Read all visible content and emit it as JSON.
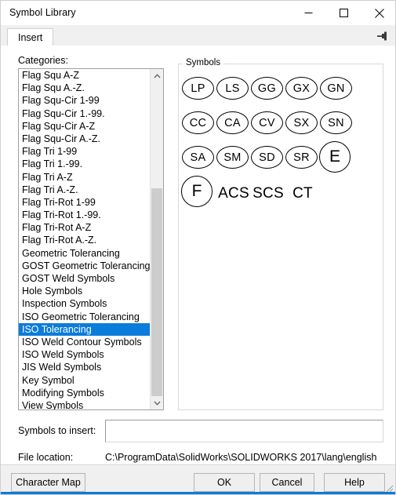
{
  "window": {
    "title": "Symbol Library",
    "controls": {
      "minimize": "minimize-icon",
      "maximize": "maximize-icon",
      "close": "close-icon"
    }
  },
  "tabs": {
    "items": [
      {
        "label": "Insert",
        "active": true
      }
    ],
    "pin": "pushpin-icon"
  },
  "categories": {
    "label": "Categories:",
    "selected": "ISO Tolerancing",
    "items": [
      "Flag Squ A-Z",
      "Flag Squ A.-Z.",
      "Flag Squ-Cir 1-99",
      "Flag Squ-Cir 1.-99.",
      "Flag Squ-Cir A-Z",
      "Flag Squ-Cir A.-Z.",
      "Flag Tri 1-99",
      "Flag Tri 1.-99.",
      "Flag Tri A-Z",
      "Flag Tri A.-Z.",
      "Flag Tri-Rot 1-99",
      "Flag Tri-Rot 1.-99.",
      "Flag Tri-Rot A-Z",
      "Flag Tri-Rot A.-Z.",
      "Geometric Tolerancing",
      "GOST Geometric Tolerancing",
      "GOST Weld Symbols",
      "Hole Symbols",
      "Inspection Symbols",
      "ISO Geometric Tolerancing",
      "ISO Tolerancing",
      "ISO Weld Contour Symbols",
      "ISO Weld Symbols",
      "JIS Weld Symbols",
      "Key Symbol",
      "Modifying Symbols",
      "View Symbols"
    ],
    "scrollbar": {
      "up_arrow": "chevron-up-icon",
      "down_arrow": "chevron-down-icon"
    }
  },
  "symbols": {
    "label": "Symbols",
    "items": [
      {
        "text": "LP",
        "shape": "oval",
        "row": 0,
        "col": 0
      },
      {
        "text": "LS",
        "shape": "oval",
        "row": 0,
        "col": 1
      },
      {
        "text": "GG",
        "shape": "oval",
        "row": 0,
        "col": 2
      },
      {
        "text": "GX",
        "shape": "oval",
        "row": 0,
        "col": 3
      },
      {
        "text": "GN",
        "shape": "oval",
        "row": 0,
        "col": 4
      },
      {
        "text": "CC",
        "shape": "oval",
        "row": 1,
        "col": 0
      },
      {
        "text": "CA",
        "shape": "oval",
        "row": 1,
        "col": 1
      },
      {
        "text": "CV",
        "shape": "oval",
        "row": 1,
        "col": 2
      },
      {
        "text": "SX",
        "shape": "oval",
        "row": 1,
        "col": 3
      },
      {
        "text": "SN",
        "shape": "oval",
        "row": 1,
        "col": 4
      },
      {
        "text": "SA",
        "shape": "oval",
        "row": 2,
        "col": 0
      },
      {
        "text": "SM",
        "shape": "oval",
        "row": 2,
        "col": 1
      },
      {
        "text": "SD",
        "shape": "oval",
        "row": 2,
        "col": 2
      },
      {
        "text": "SR",
        "shape": "oval",
        "row": 2,
        "col": 3
      },
      {
        "text": "E",
        "shape": "circle",
        "row": 2,
        "col": 4
      },
      {
        "text": "F",
        "shape": "circle",
        "row": 3,
        "col": 0
      },
      {
        "text": "ACS",
        "shape": "plain",
        "row": 3,
        "col": 1
      },
      {
        "text": "SCS",
        "shape": "plain",
        "row": 3,
        "col": 2
      },
      {
        "text": "CT",
        "shape": "plain",
        "row": 3,
        "col": 3
      }
    ]
  },
  "insert_field": {
    "label": "Symbols to insert:",
    "value": "",
    "placeholder": ""
  },
  "file_location": {
    "label": "File location:",
    "value": "C:\\ProgramData\\SolidWorks\\SOLIDWORKS 2017\\lang\\english"
  },
  "footer": {
    "character_map": "Character Map",
    "ok": "OK",
    "cancel": "Cancel",
    "help": "Help"
  },
  "colors": {
    "selection": "#0a7cdb",
    "window_bg": "#f0f0f0",
    "panel_bg": "#ffffff"
  }
}
